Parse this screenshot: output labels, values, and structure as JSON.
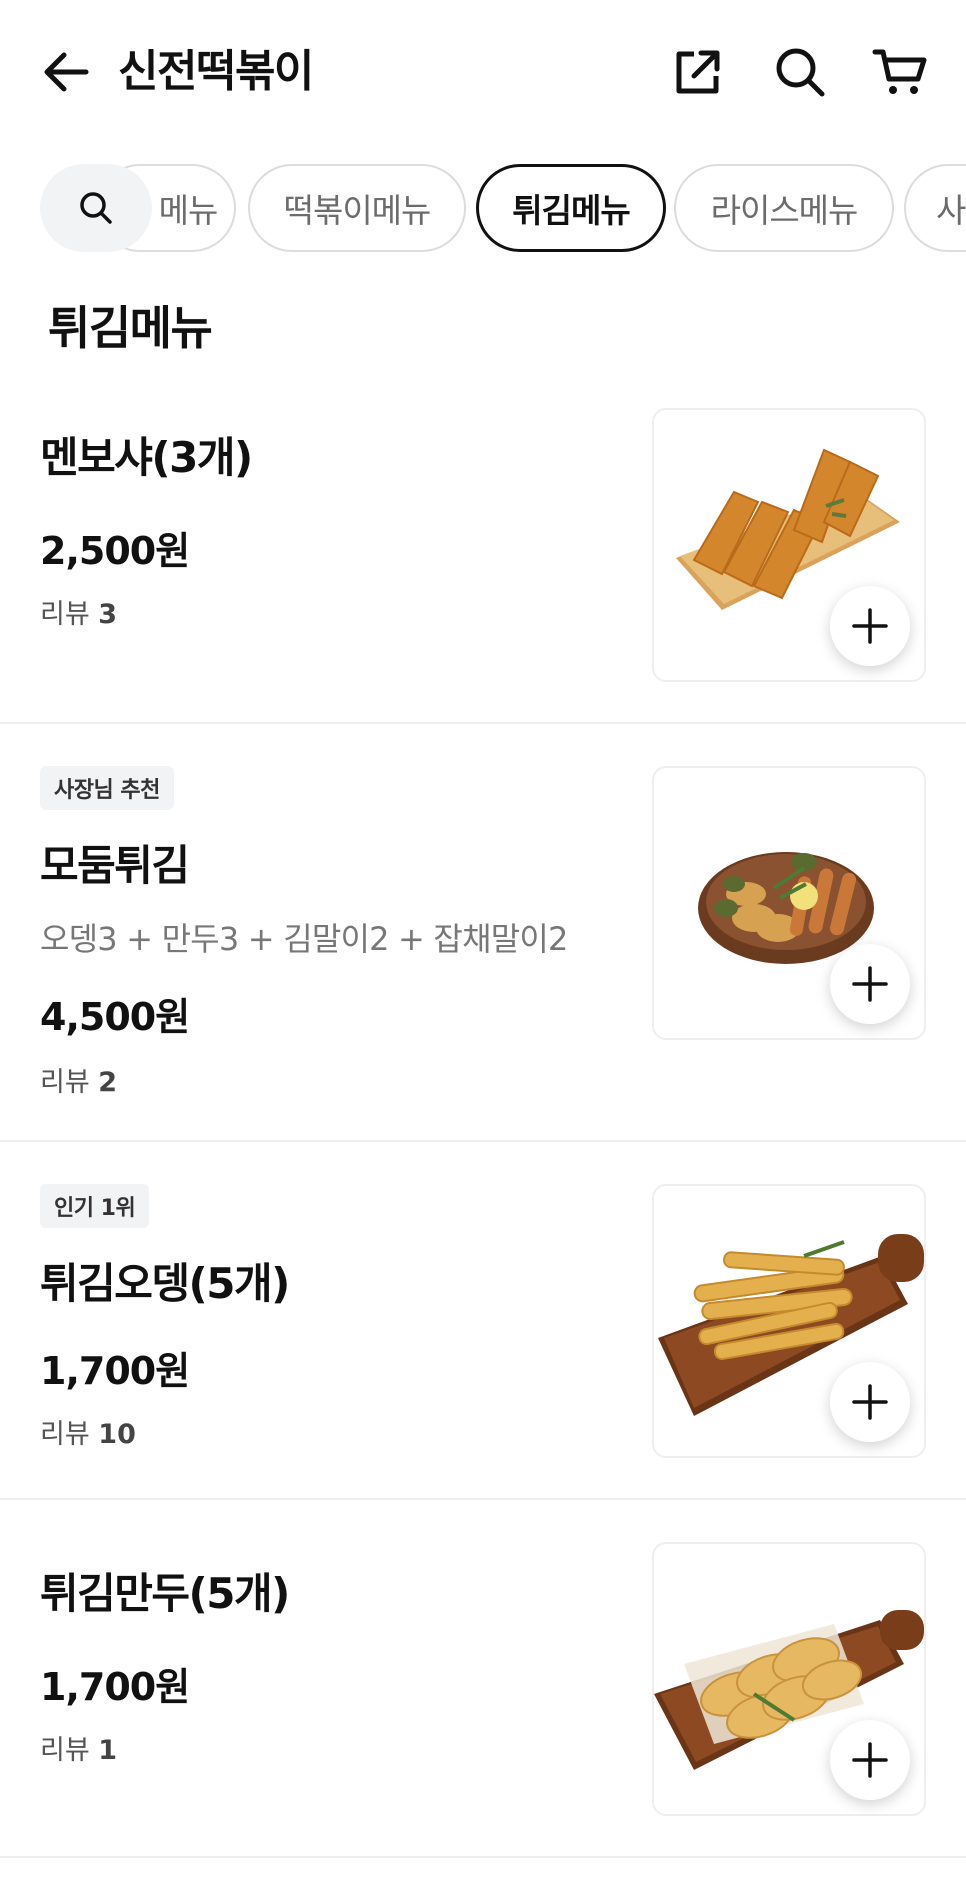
{
  "header": {
    "title": "신전떡볶이",
    "back_icon": "arrow-left-icon",
    "share_icon": "share-icon",
    "search_icon": "search-icon",
    "cart_icon": "cart-icon"
  },
  "categories": {
    "search_icon": "search-icon",
    "chips": [
      "메뉴",
      "떡볶이메뉴",
      "튀김메뉴",
      "라이스메뉴",
      "사"
    ],
    "active": "튀김메뉴"
  },
  "section": {
    "title": "튀김메뉴"
  },
  "items": [
    {
      "name": "멘보샤(3개)",
      "price": "2,500원",
      "review_label": "리뷰",
      "review_count": "3"
    },
    {
      "badge": "사장님 추천",
      "name": "모둠튀김",
      "description": "오뎅3 + 만두3 + 김말이2 + 잡채말이2",
      "price": "4,500원",
      "review_label": "리뷰",
      "review_count": "2"
    },
    {
      "badge": "인기 1위",
      "name": "튀김오뎅(5개)",
      "price": "1,700원",
      "review_label": "리뷰",
      "review_count": "10"
    },
    {
      "name": "튀김만두(5개)",
      "price": "1,700원",
      "review_label": "리뷰",
      "review_count": "1"
    }
  ],
  "colors": {
    "accent": "#111111",
    "chip_border": "#dcdcdc",
    "badge_bg": "#f2f3f5"
  }
}
